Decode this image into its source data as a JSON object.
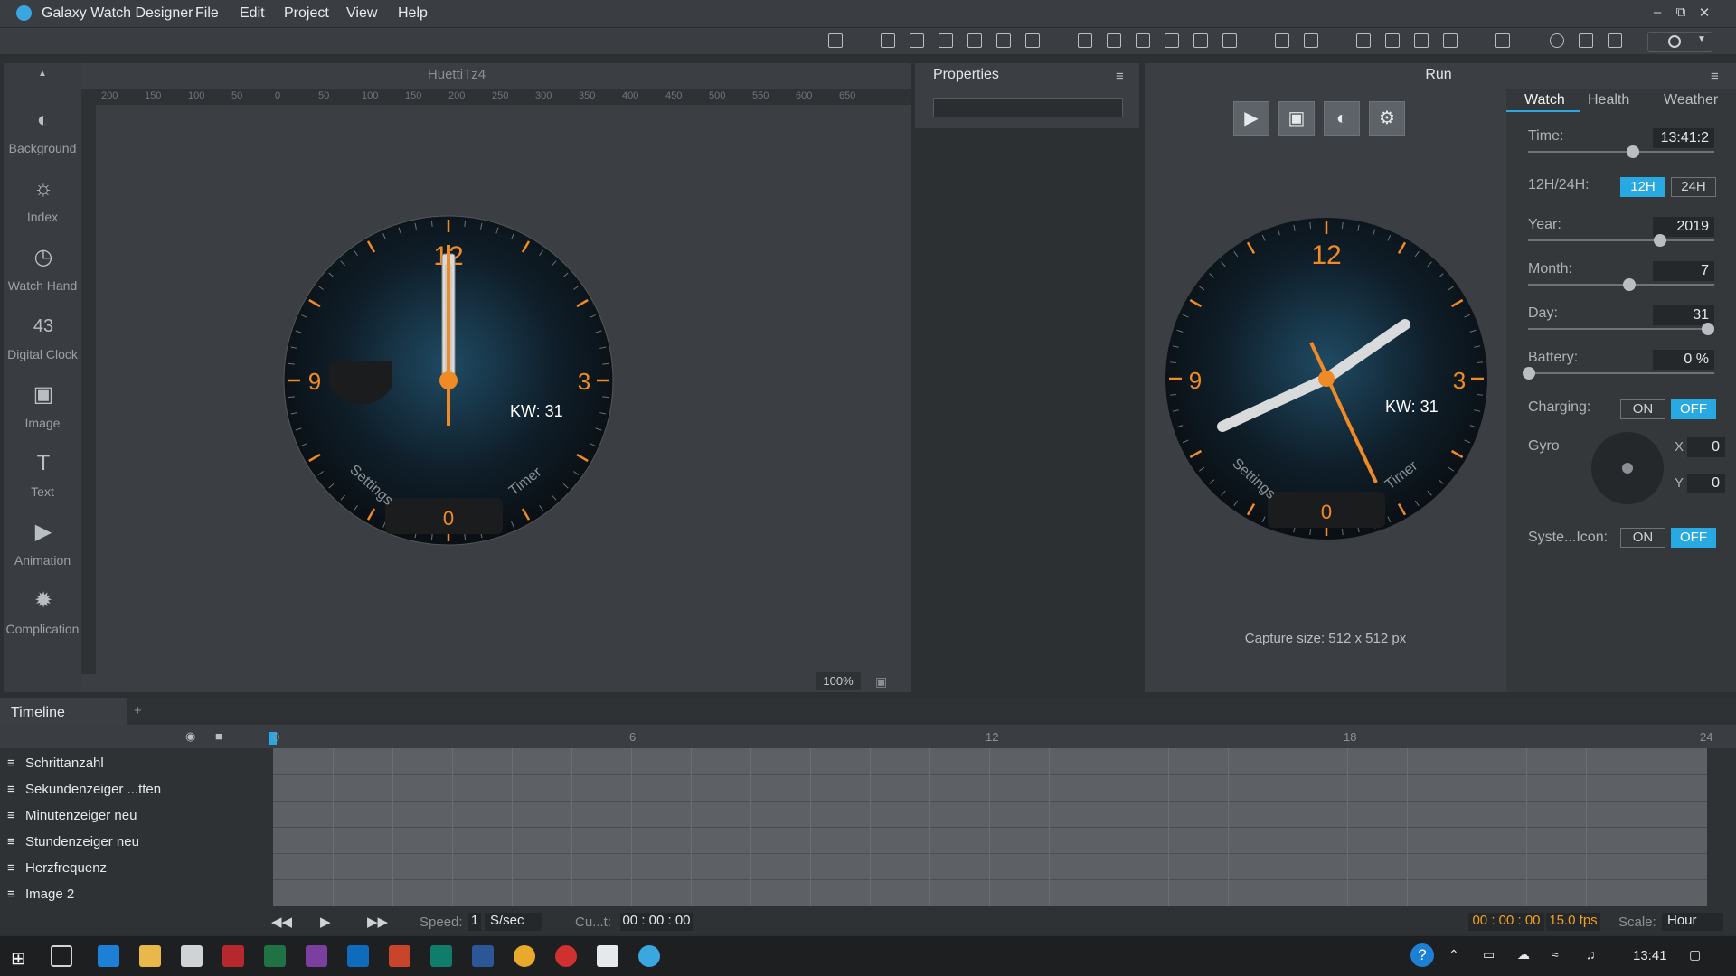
{
  "app": {
    "title": "Galaxy Watch Designer",
    "menus": [
      "File",
      "Edit",
      "Project",
      "View",
      "Help"
    ]
  },
  "tools": [
    {
      "label": "Background",
      "icon": "background-icon"
    },
    {
      "label": "Index",
      "icon": "index-icon"
    },
    {
      "label": "Watch Hand",
      "icon": "watch-hand-icon"
    },
    {
      "label": "Digital Clock",
      "icon": "digital-clock-icon"
    },
    {
      "label": "Image",
      "icon": "image-icon"
    },
    {
      "label": "Text",
      "icon": "text-icon"
    },
    {
      "label": "Animation",
      "icon": "animation-icon"
    },
    {
      "label": "Complication",
      "icon": "complication-icon"
    }
  ],
  "canvas": {
    "title": "HuettiTz4",
    "zoom": "100%",
    "ruler_ticks": [
      "200",
      "150",
      "100",
      "50",
      "0",
      "50",
      "100",
      "150",
      "200",
      "250",
      "300",
      "350",
      "400",
      "450",
      "500",
      "550",
      "600",
      "650"
    ]
  },
  "watch": {
    "numerals": {
      "twelve": "12",
      "three": "3",
      "nine": "9",
      "bottom": "0"
    },
    "week": "KW: 31",
    "left_label": "Settings",
    "right_label": "Timer"
  },
  "properties": {
    "title": "Properties",
    "search_value": ""
  },
  "run": {
    "title": "Run",
    "capture": "Capture size: 512 x 512 px"
  },
  "settings": {
    "tabs": [
      "Watch",
      "Health",
      "Weather"
    ],
    "time": {
      "label": "Time:",
      "value": "13:41:2"
    },
    "format": {
      "label": "12H/24H:",
      "h12": "12H",
      "h24": "24H"
    },
    "year": {
      "label": "Year:",
      "value": "2019"
    },
    "month": {
      "label": "Month:",
      "value": "7"
    },
    "day": {
      "label": "Day:",
      "value": "31"
    },
    "battery": {
      "label": "Battery:",
      "value": "0 %"
    },
    "charging": {
      "label": "Charging:",
      "on": "ON",
      "off": "OFF"
    },
    "gyro": {
      "label": "Gyro",
      "x_label": "X",
      "x": "0",
      "y_label": "Y",
      "y": "0"
    },
    "system_icon": {
      "label": "Syste...Icon:",
      "on": "ON",
      "off": "OFF"
    }
  },
  "timeline": {
    "tab": "Timeline",
    "add": "+",
    "scale_marks": [
      "0",
      "6",
      "12",
      "18",
      "24"
    ],
    "layers": [
      "Schrittanzahl",
      "Sekundenzeiger ...tten",
      "Minutenzeiger neu",
      "Stundenzeiger neu",
      "Herzfrequenz",
      "Image 2"
    ],
    "speed_label": "Speed:",
    "speed_value": "1",
    "speed_unit": "S/sec",
    "current_label": "Cu...t:",
    "current_value": "00 : 00 : 00",
    "time_display": "00 : 00 : 00",
    "fps": "15.0 fps",
    "scale_label": "Scale:",
    "scale_value": "Hour"
  },
  "taskbar": {
    "clock": "13:41"
  }
}
